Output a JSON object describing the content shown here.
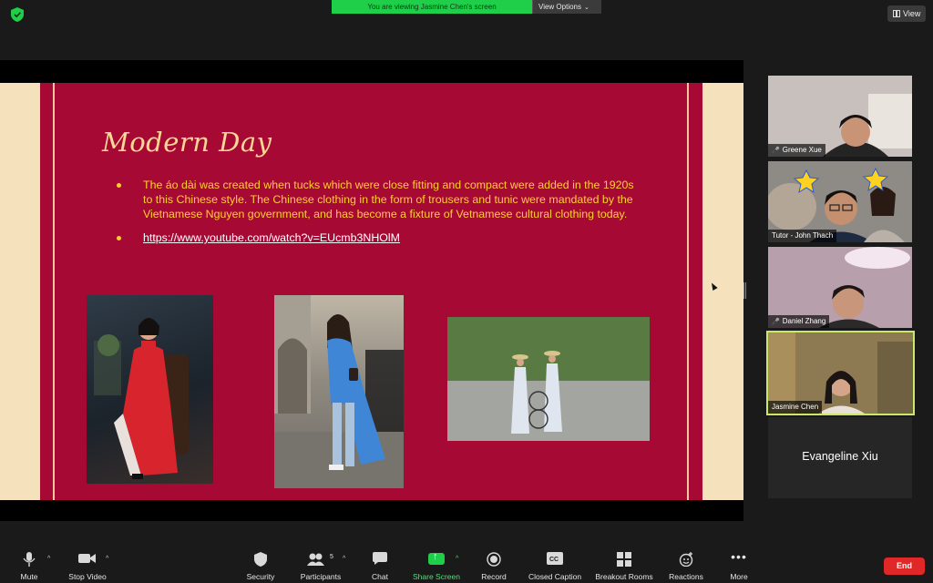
{
  "top_bar": {
    "viewing_text": "You are viewing Jasmine Chen's screen",
    "view_options_label": "View Options",
    "view_label": "View"
  },
  "slide": {
    "title": "Modern Day",
    "bullets": [
      "The áo dài was created when tucks which were close fitting and compact were added in the 1920s to this Chinese style. The Chinese clothing in the form of trousers and tunic were mandated by the Vietnamese Nguyen government, and has become a fixture of Vetnamese cultural clothing today.",
      "https://www.youtube.com/watch?v=EUcmb3NHOlM"
    ],
    "colors": {
      "background": "#a60a34",
      "accent_text": "#ffcf2e",
      "title": "#fbd896",
      "border": "#f6e1bd"
    }
  },
  "participants": [
    {
      "name": "Greene Xue",
      "muted": true
    },
    {
      "name": "Tutor - John Thach",
      "muted": false
    },
    {
      "name": "Daniel Zhang",
      "muted": true
    },
    {
      "name": "Jasmine Chen",
      "muted": false,
      "active_speaker": true
    },
    {
      "name": "Evangeline Xiu",
      "video_off": true
    }
  ],
  "toolbar": {
    "mute": "Mute",
    "stop_video": "Stop Video",
    "security": "Security",
    "participants": "Participants",
    "participant_count": "5",
    "chat": "Chat",
    "share_screen": "Share Screen",
    "record": "Record",
    "closed_caption": "Closed Caption",
    "breakout_rooms": "Breakout Rooms",
    "reactions": "Reactions",
    "more": "More",
    "end": "End"
  }
}
